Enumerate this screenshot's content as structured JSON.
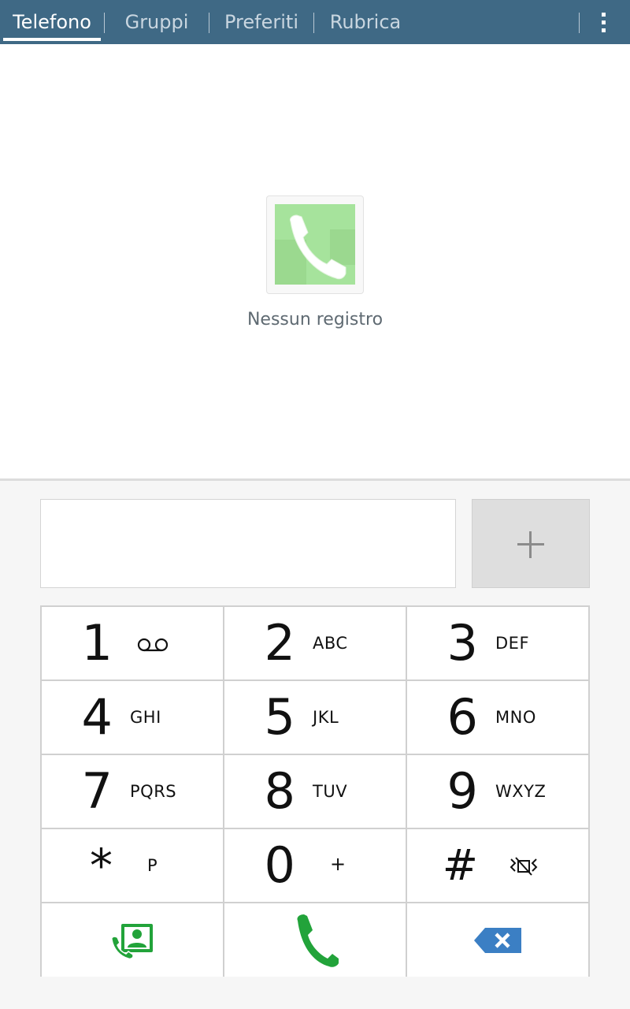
{
  "tabs": [
    {
      "label": "Telefono",
      "active": true
    },
    {
      "label": "Gruppi",
      "active": false
    },
    {
      "label": "Preferiti",
      "active": false
    },
    {
      "label": "Rubrica",
      "active": false
    }
  ],
  "overflow_icon": "more-vert-icon",
  "empty_log": {
    "icon": "phone-handset-icon",
    "text": "Nessun registro"
  },
  "number_field": {
    "value": "",
    "placeholder": ""
  },
  "add_contact_icon": "plus-icon",
  "keypad": {
    "keys": [
      {
        "digit": "1",
        "letters": "",
        "icon": "voicemail-icon"
      },
      {
        "digit": "2",
        "letters": "ABC"
      },
      {
        "digit": "3",
        "letters": "DEF"
      },
      {
        "digit": "4",
        "letters": "GHI"
      },
      {
        "digit": "5",
        "letters": "JKL"
      },
      {
        "digit": "6",
        "letters": "MNO"
      },
      {
        "digit": "7",
        "letters": "PQRS"
      },
      {
        "digit": "8",
        "letters": "TUV"
      },
      {
        "digit": "9",
        "letters": "WXYZ"
      },
      {
        "digit": "*",
        "letters": "P"
      },
      {
        "digit": "0",
        "letters": "+"
      },
      {
        "digit": "#",
        "letters": "",
        "icon": "vibrate-mute-icon"
      }
    ],
    "bottom_row": [
      {
        "icon": "contacts-call-icon",
        "color": "#22a33a"
      },
      {
        "icon": "call-icon",
        "color": "#22a33a"
      },
      {
        "icon": "backspace-icon",
        "color": "#3b7fc4"
      }
    ]
  },
  "colors": {
    "tab_bar": "#3f6985",
    "call_green": "#22a33a",
    "delete_blue": "#3b7fc4"
  }
}
